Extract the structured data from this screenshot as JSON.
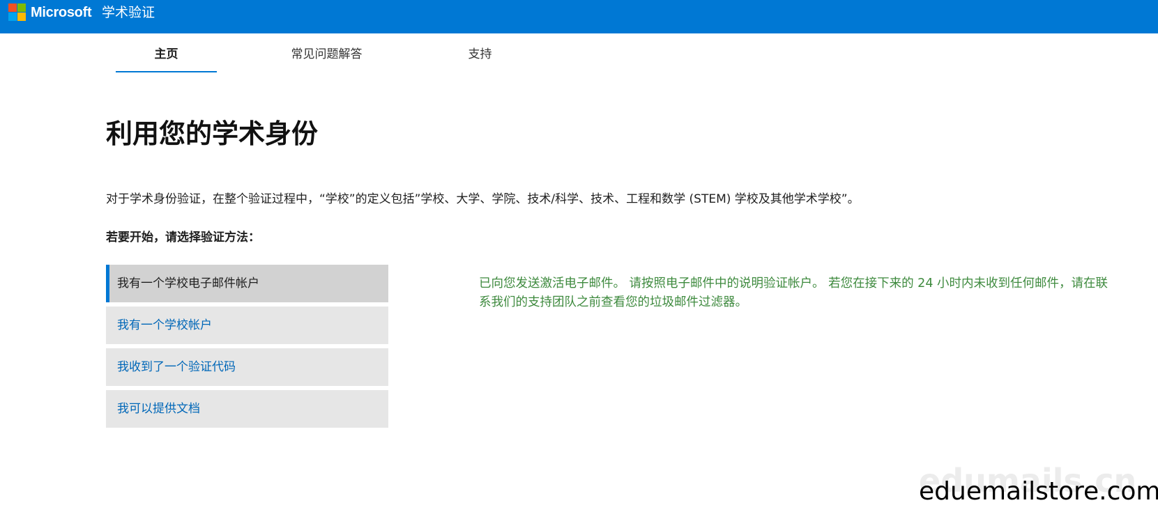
{
  "header": {
    "brand": "Microsoft",
    "product": "学术验证",
    "logo_colors": [
      "#f25022",
      "#7fba00",
      "#00a4ef",
      "#ffb900"
    ],
    "bar_color": "#0078d4"
  },
  "nav": {
    "tabs": [
      {
        "label": "主页",
        "active": true
      },
      {
        "label": "常见问题解答",
        "active": false
      },
      {
        "label": "支持",
        "active": false
      }
    ]
  },
  "main": {
    "title": "利用您的学术身份",
    "intro": "对于学术身份验证，在整个验证过程中，“学校”的定义包括”学校、大学、学院、技术/科学、技术、工程和数学 (STEM) 学校及其他学术学校”。",
    "prompt": "若要开始，请选择验证方法：",
    "options": [
      {
        "label": "我有一个学校电子邮件帐户",
        "selected": true
      },
      {
        "label": "我有一个学校帐户",
        "selected": false
      },
      {
        "label": "我收到了一个验证代码",
        "selected": false
      },
      {
        "label": "我可以提供文档",
        "selected": false
      }
    ],
    "message": "已向您发送激活电子邮件。 请按照电子邮件中的说明验证帐户。 若您在接下来的 24 小时内未收到任何邮件，请在联系我们的支持团队之前查看您的垃圾邮件过滤器。",
    "message_color": "#3e8a3e"
  },
  "watermarks": {
    "faded": "edumails.cn",
    "primary": "eduemailstore.com"
  }
}
